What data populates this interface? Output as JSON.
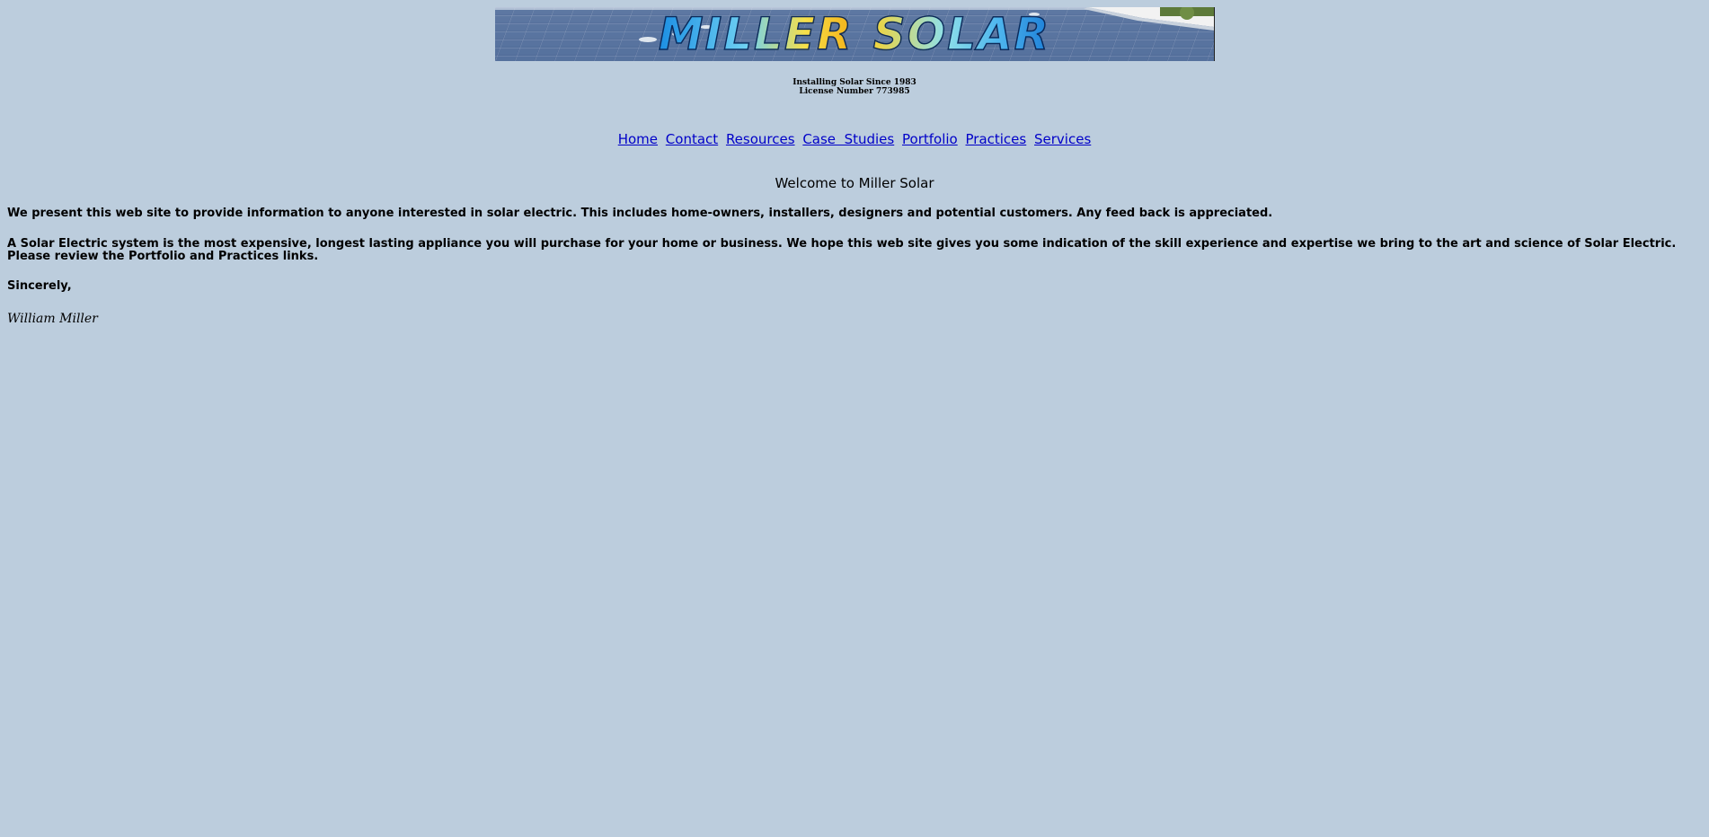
{
  "banner": {
    "word1": "MILLER",
    "word2": "SOLAR"
  },
  "tagline": {
    "line1": "Installing Solar Since 1983",
    "line2": "License Number 773985"
  },
  "nav": {
    "home": "Home",
    "contact": "Contact",
    "resources": "Resources",
    "case_studies": "Case  Studies",
    "portfolio": "Portfolio",
    "practices": "Practices",
    "services": "Services"
  },
  "welcome": "Welcome to Miller Solar",
  "body": {
    "p1": "We present this web site to provide information to anyone interested in solar electric. This includes home-owners, installers, designers and potential customers. Any feed back is appreciated.",
    "p2": "A Solar Electric system is the most expensive, longest lasting appliance you will purchase for your home or business. We hope this web site gives you some indication of the skill experience and expertise we bring to the art and science of Solar Electric. Please review the Portfolio and Practices links.",
    "closing": "Sincerely,",
    "signature": "William Miller"
  },
  "colors": {
    "background": "#bccddd",
    "link": "#0000c8"
  }
}
